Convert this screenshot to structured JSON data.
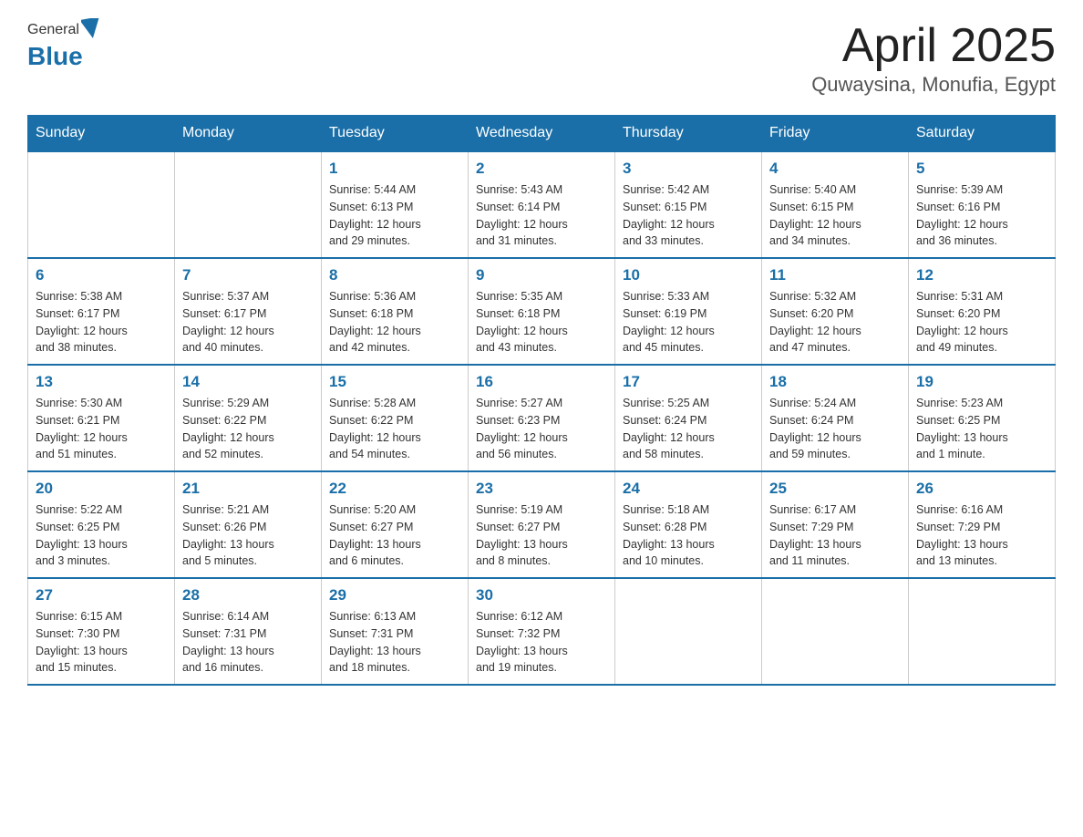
{
  "header": {
    "logo_general": "General",
    "logo_blue": "Blue",
    "title": "April 2025",
    "subtitle": "Quwaysina, Monufia, Egypt"
  },
  "days_of_week": [
    "Sunday",
    "Monday",
    "Tuesday",
    "Wednesday",
    "Thursday",
    "Friday",
    "Saturday"
  ],
  "weeks": [
    [
      {
        "day": "",
        "info": ""
      },
      {
        "day": "",
        "info": ""
      },
      {
        "day": "1",
        "info": "Sunrise: 5:44 AM\nSunset: 6:13 PM\nDaylight: 12 hours\nand 29 minutes."
      },
      {
        "day": "2",
        "info": "Sunrise: 5:43 AM\nSunset: 6:14 PM\nDaylight: 12 hours\nand 31 minutes."
      },
      {
        "day": "3",
        "info": "Sunrise: 5:42 AM\nSunset: 6:15 PM\nDaylight: 12 hours\nand 33 minutes."
      },
      {
        "day": "4",
        "info": "Sunrise: 5:40 AM\nSunset: 6:15 PM\nDaylight: 12 hours\nand 34 minutes."
      },
      {
        "day": "5",
        "info": "Sunrise: 5:39 AM\nSunset: 6:16 PM\nDaylight: 12 hours\nand 36 minutes."
      }
    ],
    [
      {
        "day": "6",
        "info": "Sunrise: 5:38 AM\nSunset: 6:17 PM\nDaylight: 12 hours\nand 38 minutes."
      },
      {
        "day": "7",
        "info": "Sunrise: 5:37 AM\nSunset: 6:17 PM\nDaylight: 12 hours\nand 40 minutes."
      },
      {
        "day": "8",
        "info": "Sunrise: 5:36 AM\nSunset: 6:18 PM\nDaylight: 12 hours\nand 42 minutes."
      },
      {
        "day": "9",
        "info": "Sunrise: 5:35 AM\nSunset: 6:18 PM\nDaylight: 12 hours\nand 43 minutes."
      },
      {
        "day": "10",
        "info": "Sunrise: 5:33 AM\nSunset: 6:19 PM\nDaylight: 12 hours\nand 45 minutes."
      },
      {
        "day": "11",
        "info": "Sunrise: 5:32 AM\nSunset: 6:20 PM\nDaylight: 12 hours\nand 47 minutes."
      },
      {
        "day": "12",
        "info": "Sunrise: 5:31 AM\nSunset: 6:20 PM\nDaylight: 12 hours\nand 49 minutes."
      }
    ],
    [
      {
        "day": "13",
        "info": "Sunrise: 5:30 AM\nSunset: 6:21 PM\nDaylight: 12 hours\nand 51 minutes."
      },
      {
        "day": "14",
        "info": "Sunrise: 5:29 AM\nSunset: 6:22 PM\nDaylight: 12 hours\nand 52 minutes."
      },
      {
        "day": "15",
        "info": "Sunrise: 5:28 AM\nSunset: 6:22 PM\nDaylight: 12 hours\nand 54 minutes."
      },
      {
        "day": "16",
        "info": "Sunrise: 5:27 AM\nSunset: 6:23 PM\nDaylight: 12 hours\nand 56 minutes."
      },
      {
        "day": "17",
        "info": "Sunrise: 5:25 AM\nSunset: 6:24 PM\nDaylight: 12 hours\nand 58 minutes."
      },
      {
        "day": "18",
        "info": "Sunrise: 5:24 AM\nSunset: 6:24 PM\nDaylight: 12 hours\nand 59 minutes."
      },
      {
        "day": "19",
        "info": "Sunrise: 5:23 AM\nSunset: 6:25 PM\nDaylight: 13 hours\nand 1 minute."
      }
    ],
    [
      {
        "day": "20",
        "info": "Sunrise: 5:22 AM\nSunset: 6:25 PM\nDaylight: 13 hours\nand 3 minutes."
      },
      {
        "day": "21",
        "info": "Sunrise: 5:21 AM\nSunset: 6:26 PM\nDaylight: 13 hours\nand 5 minutes."
      },
      {
        "day": "22",
        "info": "Sunrise: 5:20 AM\nSunset: 6:27 PM\nDaylight: 13 hours\nand 6 minutes."
      },
      {
        "day": "23",
        "info": "Sunrise: 5:19 AM\nSunset: 6:27 PM\nDaylight: 13 hours\nand 8 minutes."
      },
      {
        "day": "24",
        "info": "Sunrise: 5:18 AM\nSunset: 6:28 PM\nDaylight: 13 hours\nand 10 minutes."
      },
      {
        "day": "25",
        "info": "Sunrise: 6:17 AM\nSunset: 7:29 PM\nDaylight: 13 hours\nand 11 minutes."
      },
      {
        "day": "26",
        "info": "Sunrise: 6:16 AM\nSunset: 7:29 PM\nDaylight: 13 hours\nand 13 minutes."
      }
    ],
    [
      {
        "day": "27",
        "info": "Sunrise: 6:15 AM\nSunset: 7:30 PM\nDaylight: 13 hours\nand 15 minutes."
      },
      {
        "day": "28",
        "info": "Sunrise: 6:14 AM\nSunset: 7:31 PM\nDaylight: 13 hours\nand 16 minutes."
      },
      {
        "day": "29",
        "info": "Sunrise: 6:13 AM\nSunset: 7:31 PM\nDaylight: 13 hours\nand 18 minutes."
      },
      {
        "day": "30",
        "info": "Sunrise: 6:12 AM\nSunset: 7:32 PM\nDaylight: 13 hours\nand 19 minutes."
      },
      {
        "day": "",
        "info": ""
      },
      {
        "day": "",
        "info": ""
      },
      {
        "day": "",
        "info": ""
      }
    ]
  ]
}
